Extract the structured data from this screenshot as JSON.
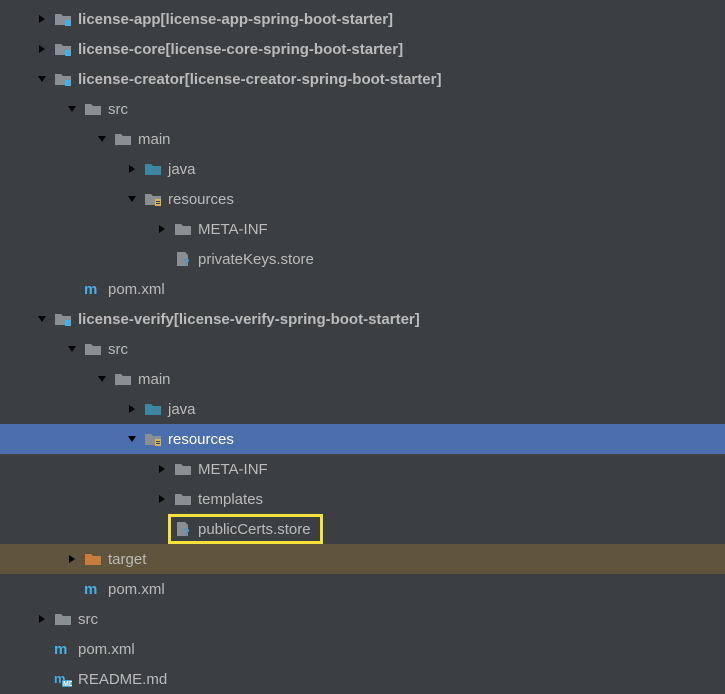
{
  "rows": [
    {
      "indent": 0,
      "arrow": "right",
      "icon": "module",
      "name": "license-app",
      "suffix": " [license-app-spring-boot-starter]",
      "interact": true,
      "bold": true
    },
    {
      "indent": 0,
      "arrow": "right",
      "icon": "module",
      "name": "license-core",
      "suffix": " [license-core-spring-boot-starter]",
      "interact": true,
      "bold": true
    },
    {
      "indent": 0,
      "arrow": "down",
      "icon": "module",
      "name": "license-creator",
      "suffix": " [license-creator-spring-boot-starter]",
      "interact": true,
      "bold": true
    },
    {
      "indent": 1,
      "arrow": "down",
      "icon": "folder",
      "name": "src",
      "interact": true
    },
    {
      "indent": 2,
      "arrow": "down",
      "icon": "folder",
      "name": "main",
      "interact": true
    },
    {
      "indent": 3,
      "arrow": "right",
      "icon": "src",
      "name": "java",
      "interact": true
    },
    {
      "indent": 3,
      "arrow": "down",
      "icon": "res",
      "name": "resources",
      "interact": true
    },
    {
      "indent": 4,
      "arrow": "right",
      "icon": "folder",
      "name": "META-INF",
      "interact": true
    },
    {
      "indent": 4,
      "arrow": "none",
      "icon": "unknown",
      "name": "privateKeys.store",
      "interact": true
    },
    {
      "indent": 1,
      "arrow": "none",
      "icon": "maven",
      "name": "pom.xml",
      "interact": true
    },
    {
      "indent": 0,
      "arrow": "down",
      "icon": "module",
      "name": "license-verify",
      "suffix": " [license-verify-spring-boot-starter]",
      "interact": true,
      "bold": true
    },
    {
      "indent": 1,
      "arrow": "down",
      "icon": "folder",
      "name": "src",
      "interact": true
    },
    {
      "indent": 2,
      "arrow": "down",
      "icon": "folder",
      "name": "main",
      "interact": true
    },
    {
      "indent": 3,
      "arrow": "right",
      "icon": "src",
      "name": "java",
      "interact": true
    },
    {
      "indent": 3,
      "arrow": "down",
      "icon": "res",
      "name": "resources",
      "interact": true,
      "selected": true
    },
    {
      "indent": 4,
      "arrow": "right",
      "icon": "folder",
      "name": "META-INF",
      "interact": true
    },
    {
      "indent": 4,
      "arrow": "right",
      "icon": "folder",
      "name": "templates",
      "interact": true
    },
    {
      "indent": 4,
      "arrow": "none",
      "icon": "unknown",
      "name": "publicCerts.store",
      "interact": true,
      "highlight": true
    },
    {
      "indent": 1,
      "arrow": "right",
      "icon": "target",
      "name": "target",
      "interact": true,
      "target": true
    },
    {
      "indent": 1,
      "arrow": "none",
      "icon": "maven",
      "name": "pom.xml",
      "interact": true
    },
    {
      "indent": 0,
      "arrow": "right",
      "icon": "folder",
      "name": "src",
      "interact": true
    },
    {
      "indent": 0,
      "arrow": "none",
      "icon": "maven",
      "name": "pom.xml",
      "interact": true
    },
    {
      "indent": 0,
      "arrow": "none",
      "icon": "md",
      "name": "README.md",
      "interact": true
    }
  ],
  "indentBase": 34,
  "indentStep": 30,
  "highlightPad": 6
}
